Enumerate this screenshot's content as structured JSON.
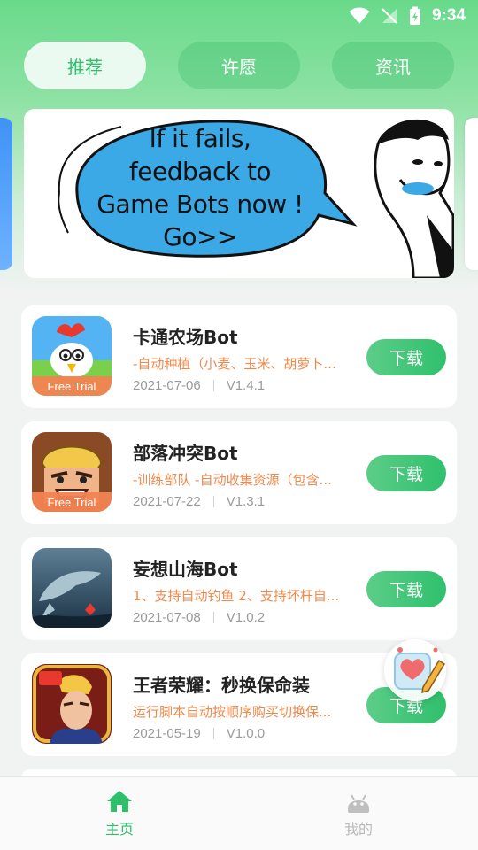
{
  "status_bar": {
    "time": "9:34"
  },
  "tabs": [
    {
      "label": "推荐",
      "active": true
    },
    {
      "label": "许愿",
      "active": false
    },
    {
      "label": "资讯",
      "active": false
    }
  ],
  "banner": {
    "lines": [
      "If it fails,",
      "feedback to",
      "Game Bots now !",
      "Go>>"
    ]
  },
  "apps": [
    {
      "title": "卡通农场Bot",
      "desc": "-自动种植（小麦、玉米、胡萝卜...",
      "date": "2021-07-06",
      "version": "V1.4.1",
      "badge": "Free Trial",
      "button": "下载"
    },
    {
      "title": "部落冲突Bot",
      "desc": "-训练部队 -自动收集资源（包含...",
      "date": "2021-07-22",
      "version": "V1.3.1",
      "badge": "Free Trial",
      "button": "下载"
    },
    {
      "title": "妄想山海Bot",
      "desc": "1、支持自动钓鱼 2、支持坏杆自...",
      "date": "2021-07-08",
      "version": "V1.0.2",
      "badge": "",
      "button": "下载"
    },
    {
      "title": "王者荣耀：秒换保命装",
      "desc": "运行脚本自动按顺序购买切换保...",
      "date": "2021-05-19",
      "version": "V1.0.0",
      "badge": "",
      "button": "下载"
    }
  ],
  "bottom_nav": [
    {
      "label": "主页",
      "icon": "home-icon",
      "active": true
    },
    {
      "label": "我的",
      "icon": "android-icon",
      "active": false
    }
  ],
  "colors": {
    "accent": "#2fbf6a",
    "desc": "#f0894b",
    "trial_badge": "#f38250"
  }
}
